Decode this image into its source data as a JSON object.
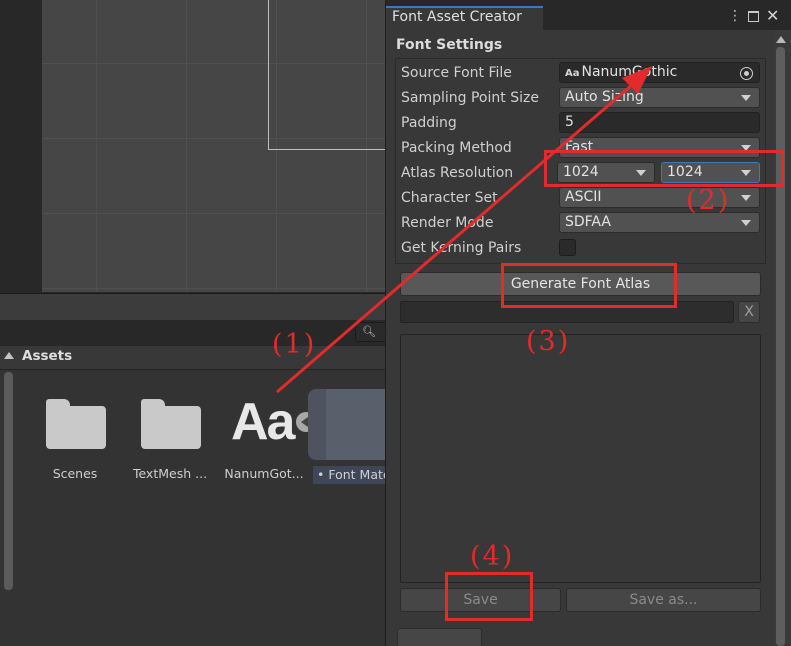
{
  "project": {
    "search_icon": "magnifier-icon",
    "assets_title": "Assets",
    "items": [
      {
        "label": "Scenes",
        "icon": "folder-icon"
      },
      {
        "label": "TextMesh ...",
        "icon": "folder-icon"
      },
      {
        "label": "NanumGot...",
        "glyph": "Aa"
      },
      {
        "label": "• Font Mate",
        "icon": "material-thumbnail"
      }
    ]
  },
  "window": {
    "tab_title": "Font Asset Creator",
    "menu_icon": "⋮",
    "close_icon": "✕",
    "section_title": "Font Settings",
    "fields": {
      "source_font_file": {
        "label": "Source Font File",
        "value": "NanumGothic",
        "icon_text": "Aa"
      },
      "sampling_point_size": {
        "label": "Sampling Point Size",
        "value": "Auto Sizing"
      },
      "padding": {
        "label": "Padding",
        "value": "5"
      },
      "packing_method": {
        "label": "Packing Method",
        "value": "Fast"
      },
      "atlas_resolution": {
        "label": "Atlas Resolution",
        "width": "1024",
        "height": "1024"
      },
      "character_set": {
        "label": "Character Set",
        "value": "ASCII"
      },
      "render_mode": {
        "label": "Render Mode",
        "value": "SDFAA"
      },
      "get_kerning_pairs": {
        "label": "Get Kerning Pairs",
        "checked": false
      }
    },
    "generate_button": "Generate Font Atlas",
    "clear_button": "X",
    "save_button": "Save",
    "save_as_button": "Save as..."
  },
  "annotations": {
    "color": "#e32b2b",
    "step1": "(1)",
    "step2": "(2)",
    "step3": "(3)",
    "step4": "(4)"
  }
}
